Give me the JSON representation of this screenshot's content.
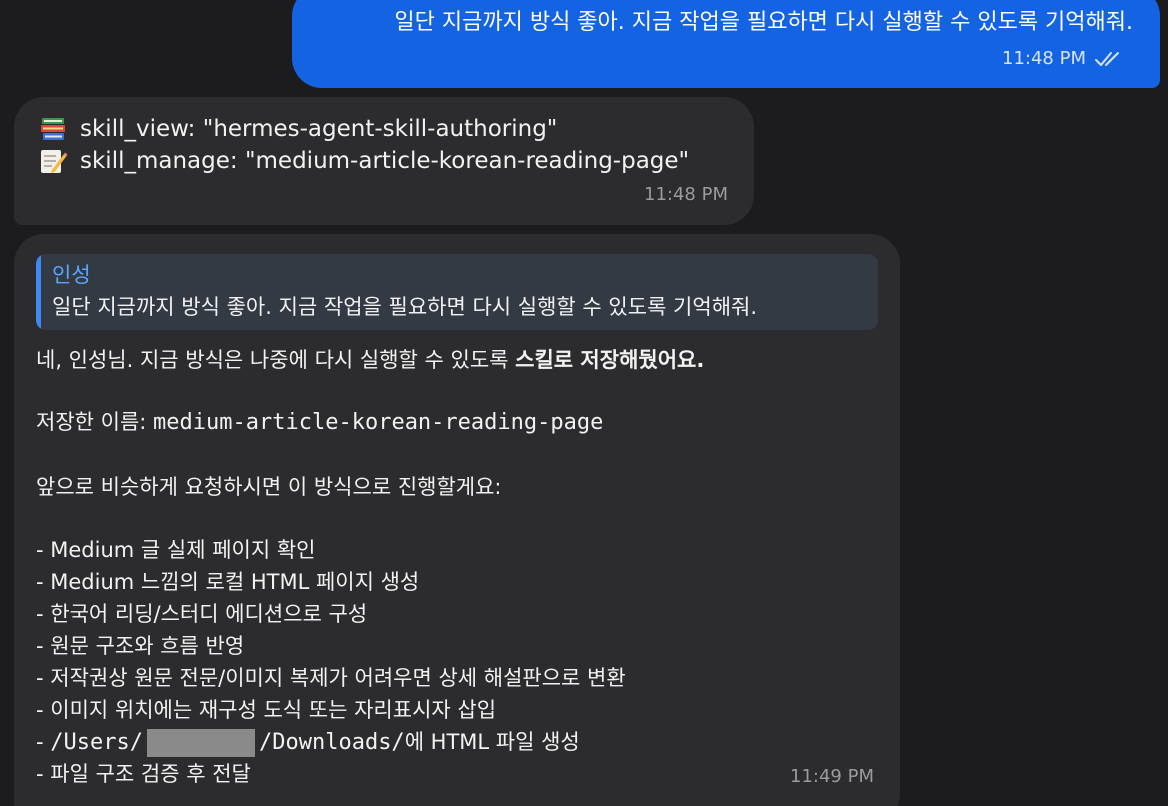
{
  "messages": {
    "outgoing": {
      "text": "일단 지금까지 방식 좋아. 지금 작업을 필요하면 다시 실행할 수 있도록 기억해줘.",
      "time": "11:48 PM"
    },
    "tool": {
      "line1_icon": "books-icon",
      "line1": "skill_view: \"hermes-agent-skill-authoring\"",
      "line2_icon": "memo-icon",
      "line2": "skill_manage: \"medium-article-korean-reading-page\"",
      "time": "11:48 PM"
    },
    "reply": {
      "quote_author": "인성",
      "quote_text": "일단 지금까지 방식 좋아. 지금 작업을 필요하면 다시 실행할 수 있도록 기억해줘.",
      "intro_plain": "네, 인성님. 지금 방식은 나중에 다시 실행할 수 있도록 ",
      "intro_bold": "스킬로 저장해뒀어요.",
      "saved_label": "저장한 이름: ",
      "saved_name": "medium-article-korean-reading-page",
      "next_line": "앞으로 비슷하게 요청하시면 이 방식으로 진행할게요:",
      "bullets": [
        "- Medium 글 실제 페이지 확인",
        "- Medium 느낌의 로컬 HTML 페이지 생성",
        "- 한국어 리딩/스터디 에디션으로 구성",
        "- 원문 구조와 흐름 반영",
        "- 저작권상 원문 전문/이미지 복제가 어려우면 상세 해설판으로 변환",
        "- 이미지 위치에는 재구성 도식 또는 자리표시자 삽입"
      ],
      "path_prefix": "- ",
      "path_a": "/Users/",
      "path_b": "/Downloads/",
      "path_suffix": "에 HTML 파일 생성",
      "last_bullet": "- 파일 구조 검증 후 전달",
      "time": "11:49 PM"
    }
  },
  "colors": {
    "background": "#1c1c1e",
    "outgoing_bubble": "#1463e3",
    "incoming_bubble": "#2c2c2e",
    "quote_accent": "#3d8bf2"
  }
}
